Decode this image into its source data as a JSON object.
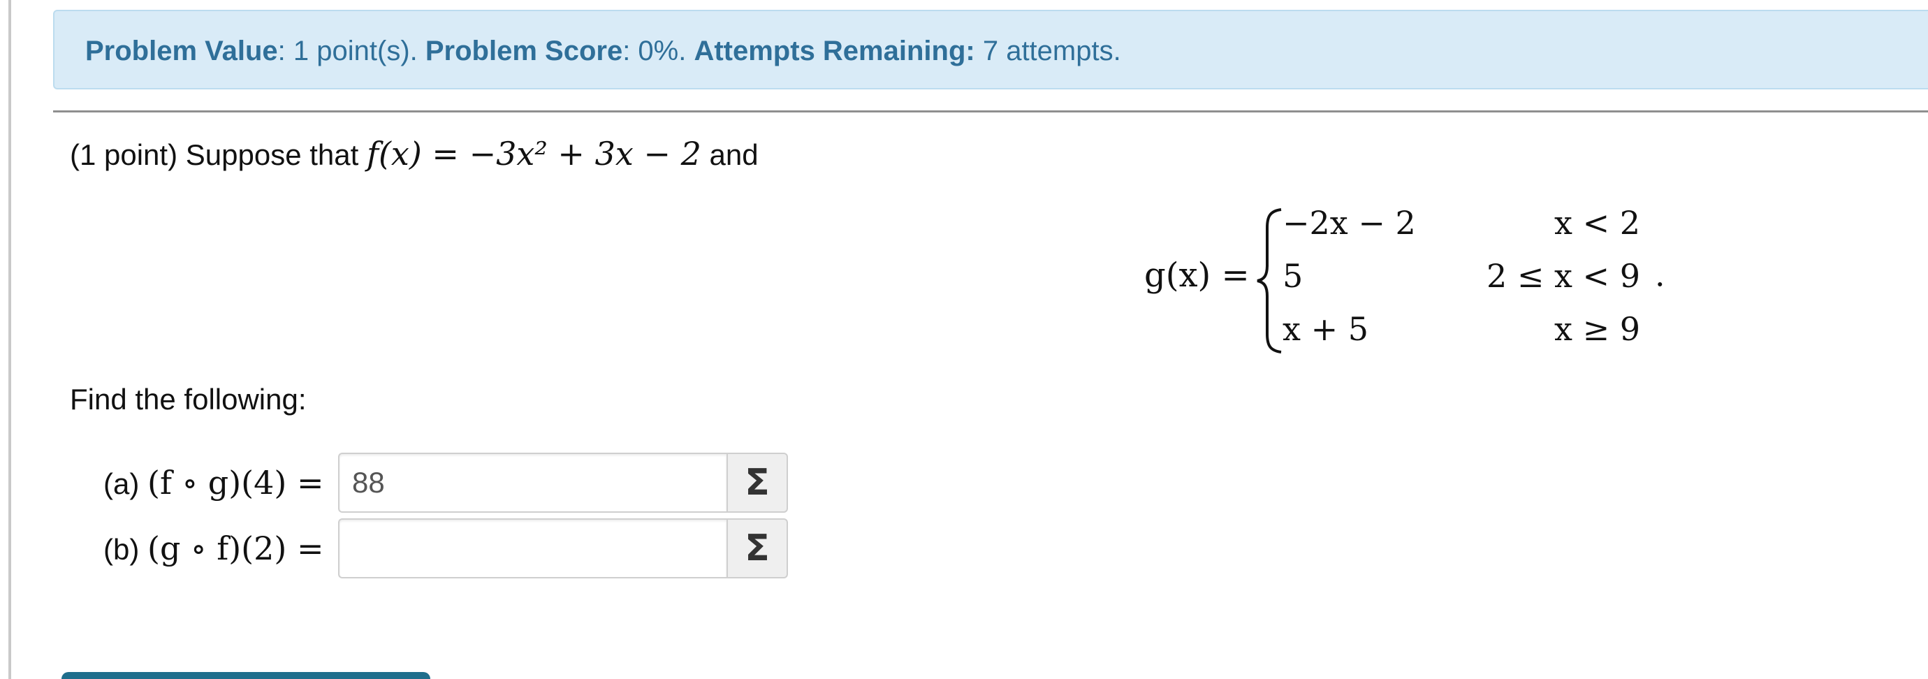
{
  "status": {
    "value_label": "Problem Value",
    "value_text": ": 1 point(s). ",
    "score_label": "Problem Score",
    "score_text": ": 0%. ",
    "attempts_label": "Attempts Remaining:",
    "attempts_text": " 7 attempts."
  },
  "problem": {
    "intro_prefix": "(1 point) Suppose that ",
    "intro_suffix": " and",
    "f_definition": "f(x) = −3x² + 3x − 2",
    "g_label": "g(x) =",
    "cases": [
      {
        "expr": "−2x − 2",
        "cond": "x < 2"
      },
      {
        "expr": "5",
        "cond": "2 ≤ x < 9"
      },
      {
        "expr": "x + 5",
        "cond": "x ≥ 9"
      }
    ],
    "trailing_dot": "·",
    "find_text": "Find the following:"
  },
  "answers": [
    {
      "label_prefix": "(a) ",
      "expression": "(f ∘ g)(4) =",
      "value": "88",
      "placeholder": "",
      "button_label": "Σ"
    },
    {
      "label_prefix": "(b) ",
      "expression": "(g ∘ f)(2) =",
      "value": "",
      "placeholder": "",
      "button_label": "Σ"
    }
  ],
  "colors": {
    "banner_bg": "#d9ebf7",
    "banner_text": "#2f6f99",
    "submit": "#1f6e8c"
  }
}
